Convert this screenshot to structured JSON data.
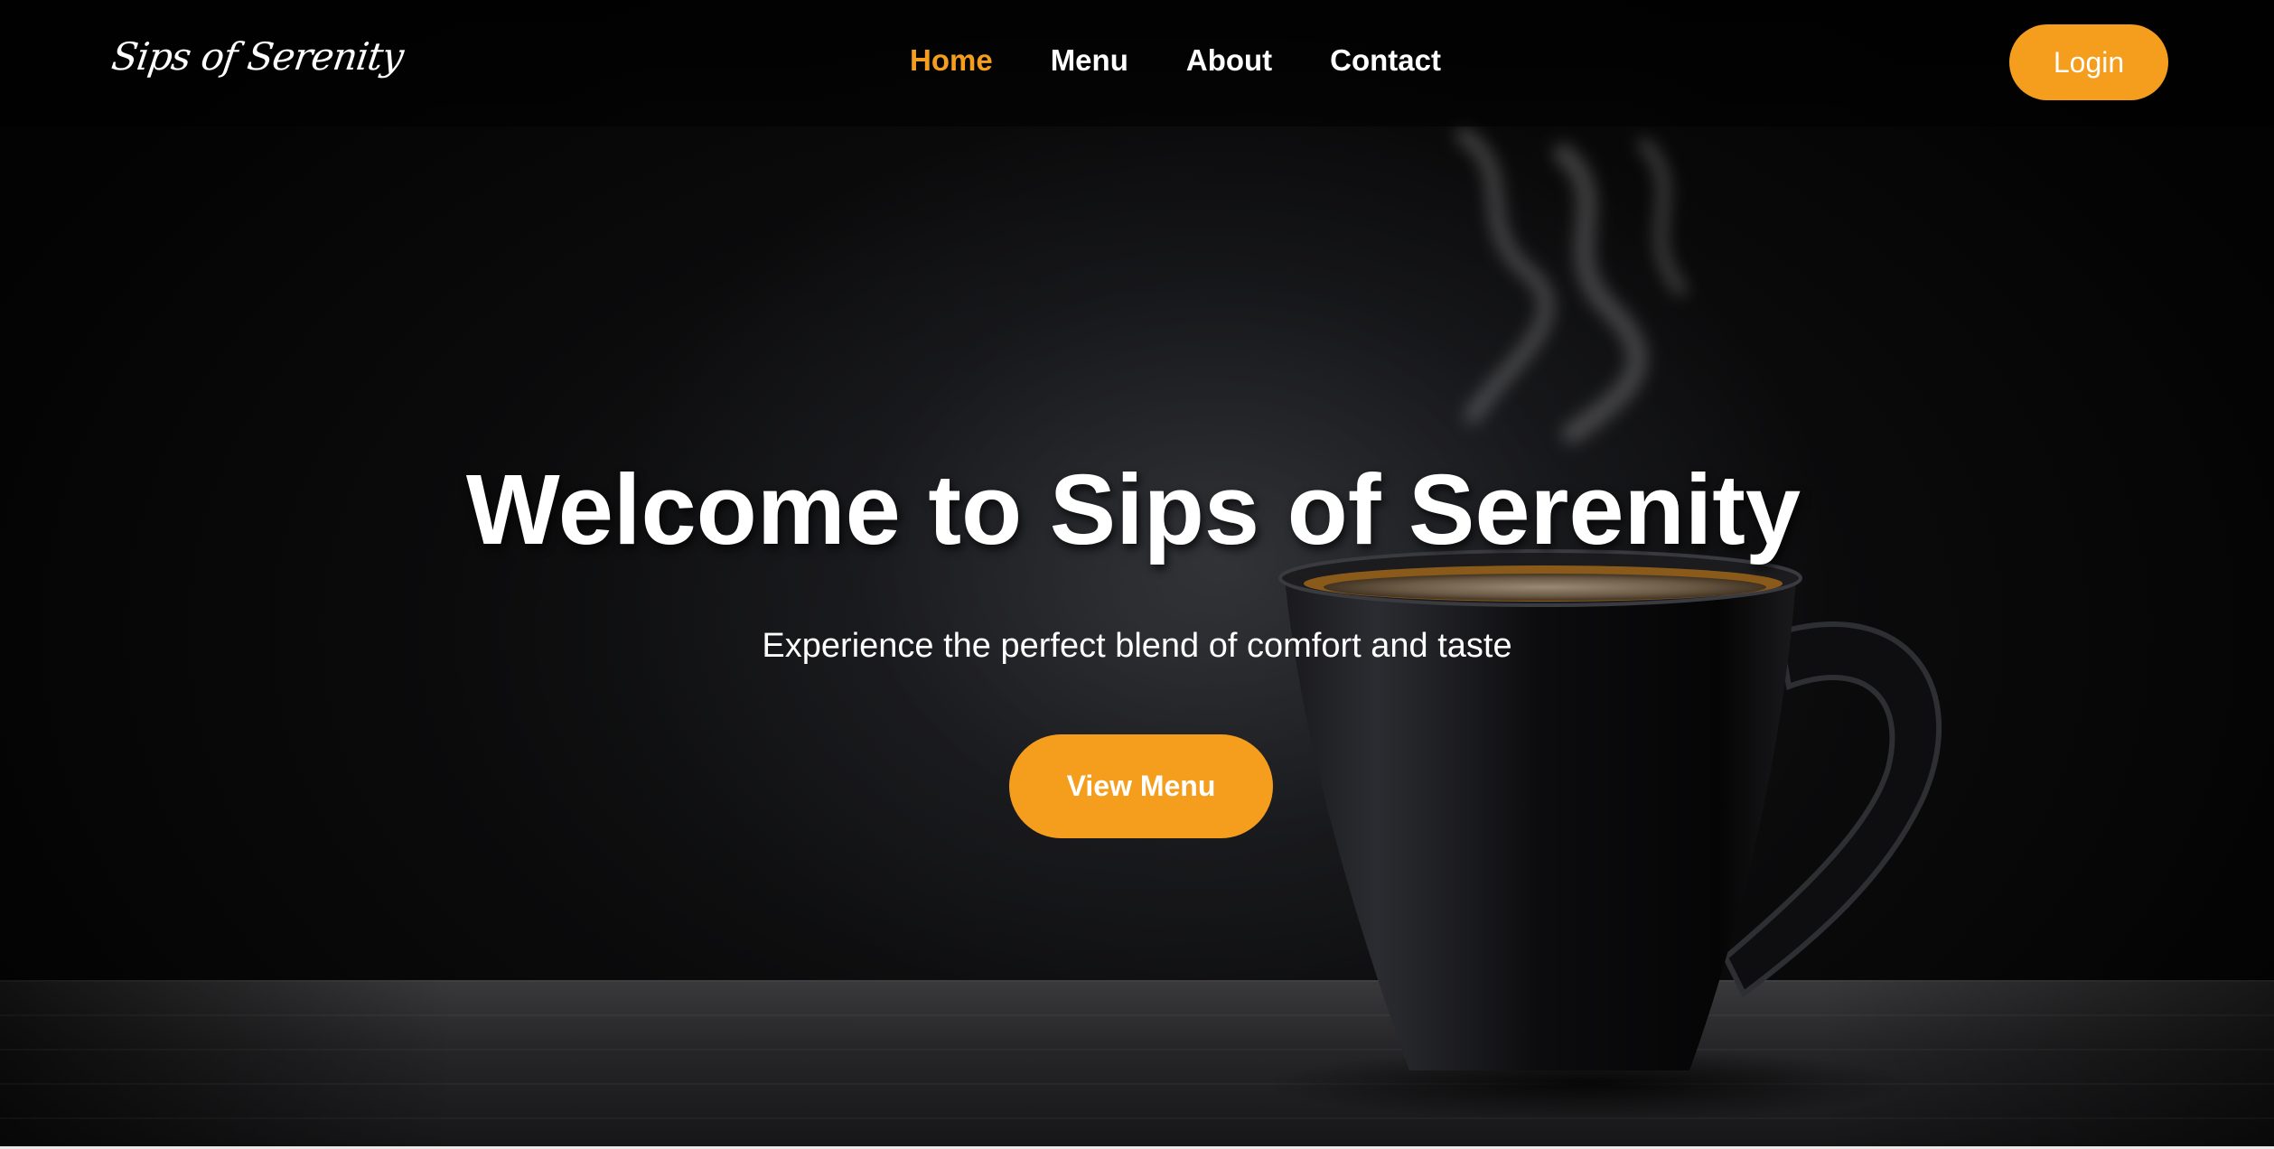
{
  "brand": {
    "logo_text": "Sips of Serenity"
  },
  "nav": {
    "items": [
      {
        "label": "Home",
        "active": true
      },
      {
        "label": "Menu",
        "active": false
      },
      {
        "label": "About",
        "active": false
      },
      {
        "label": "Contact",
        "active": false
      }
    ],
    "login_label": "Login"
  },
  "hero": {
    "title": "Welcome to Sips of Serenity",
    "subtitle": "Experience the perfect blend of comfort and taste",
    "cta_label": "View Menu",
    "background_image": "coffee-mug-with-steam"
  },
  "colors": {
    "accent": "#f59e1e",
    "text": "#ffffff",
    "background": "#0b0b0c"
  }
}
